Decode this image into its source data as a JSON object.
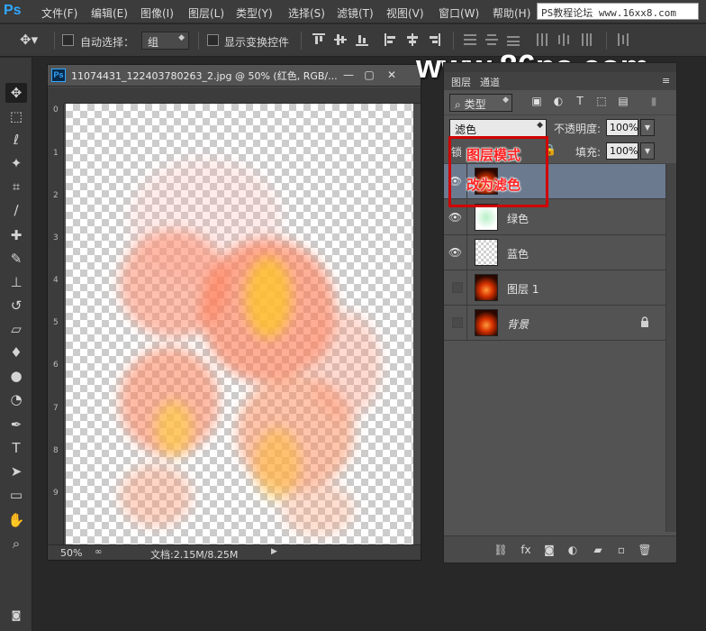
{
  "app": {
    "logo": "Ps"
  },
  "menu": [
    "文件(F)",
    "编辑(E)",
    "图像(I)",
    "图层(L)",
    "类型(Y)",
    "选择(S)",
    "滤镜(T)",
    "视图(V)",
    "窗口(W)",
    "帮助(H)"
  ],
  "watermark_top": "PS教程论坛 www.16xx8.com",
  "options": {
    "auto_select_label": "自动选择：",
    "auto_select_value": "组",
    "show_transform_label": "显示变换控件"
  },
  "document": {
    "title": "11074431_122403780263_2.jpg @ 50% (红色, RGB/...",
    "ruler_v": [
      "0",
      "1",
      "2",
      "3",
      "4",
      "5",
      "6",
      "7",
      "8",
      "9"
    ],
    "zoom": "50%",
    "doc_info": "文档:2.15M/8.25M"
  },
  "watermark_big": "www.86ps.com",
  "layers_panel": {
    "tabs": [
      "图层",
      "通道"
    ],
    "filter_kind": "类型",
    "blend_mode": "滤色",
    "opacity_label": "不透明度:",
    "opacity_value": "100%",
    "lock_label": "锁",
    "fill_label": "填充:",
    "fill_value": "100%",
    "layers": [
      {
        "name": "",
        "visible": true,
        "thumb": "fire"
      },
      {
        "name": "绿色",
        "visible": true,
        "thumb": "green"
      },
      {
        "name": "蓝色",
        "visible": true,
        "thumb": "trans"
      },
      {
        "name": "图层 1",
        "visible": false,
        "thumb": "fire"
      },
      {
        "name": "背景",
        "visible": false,
        "thumb": "fire",
        "locked": true
      }
    ]
  },
  "annotation": {
    "line1": "图层模式",
    "line2": "改为滤色",
    "color": "#ff2222"
  }
}
